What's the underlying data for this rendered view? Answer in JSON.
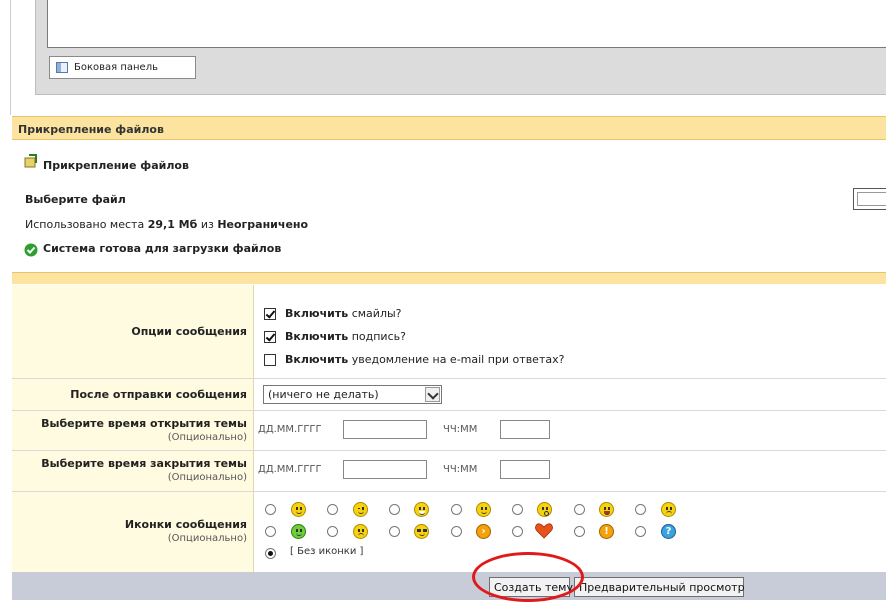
{
  "editor": {
    "sidebar_button_label": "Боковая панель"
  },
  "attachments": {
    "header": "Прикрепление файлов",
    "title": "Прикрепление файлов",
    "choose_file_label": "Выберите файл",
    "usage_prefix": "Использовано места",
    "usage_used": "29,1 Мб",
    "usage_of": "из",
    "usage_limit": "Неограничено",
    "ready_text": "Система готова для загрузки файлов"
  },
  "message_options": {
    "label": "Опции сообщения",
    "options": [
      {
        "bold": "Включить",
        "rest": "смайлы?",
        "checked": true
      },
      {
        "bold": "Включить",
        "rest": "подпись?",
        "checked": true
      },
      {
        "bold": "Включить",
        "rest": "уведомление на e-mail при ответах?",
        "checked": false
      }
    ]
  },
  "after_post": {
    "label": "После отправки сообщения",
    "selected": "(ничего не делать)"
  },
  "open_time": {
    "label": "Выберите время открытия темы",
    "sub": "(Опционально)",
    "date_label": "ДД.ММ.ГГГГ",
    "time_label": "ЧЧ:ММ",
    "date_value": "",
    "time_value": ""
  },
  "close_time": {
    "label": "Выберите время закрытия темы",
    "sub": "(Опционально)",
    "date_label": "ДД.ММ.ГГГГ",
    "time_label": "ЧЧ:ММ",
    "date_value": "",
    "time_value": ""
  },
  "message_icons": {
    "label": "Иконки сообщения",
    "sub": "(Опционально)",
    "row1": [
      "smile-icon",
      "wink-icon",
      "grin-icon",
      "blush-icon",
      "surprised-icon",
      "laugh-icon",
      "angry-icon"
    ],
    "row2": [
      "alien-icon",
      "sad-icon",
      "cool-icon",
      "arrow-icon",
      "heart-icon",
      "exclamation-icon",
      "question-icon"
    ],
    "no_icon_label": "[ Без иконки ]",
    "selected": "none"
  },
  "buttons": {
    "submit": "Создать тему",
    "preview": "Предварительный просмотр"
  },
  "colors": {
    "header_bg": "#fce4a0",
    "label_bg": "#fffbe0",
    "bottom_bar": "#c8ccd8",
    "annotation": "#e01a1a"
  }
}
